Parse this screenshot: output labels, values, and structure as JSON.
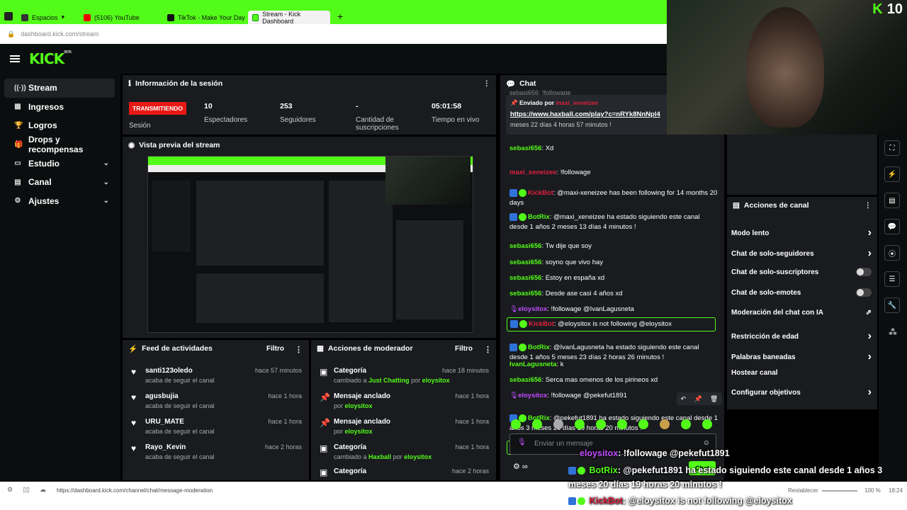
{
  "browser": {
    "tabs": [
      {
        "label": "Espacios"
      },
      {
        "label": "(5106) YouTube"
      },
      {
        "label": "TikTok - Make Your Day"
      },
      {
        "label": "Stream - Kick Dashboard"
      }
    ],
    "url_host": "dashboard.kick.com",
    "url_path": "/stream",
    "status_url": "https://dashboard.kick.com/channel/chat/message-moderation",
    "zoom_label": "Restablecer",
    "zoom": "100 %",
    "clock": "18:24"
  },
  "header": {
    "logo": "KICK",
    "beta": "BETA"
  },
  "sidebar": {
    "items": [
      {
        "label": "Stream",
        "icon": "((·))"
      },
      {
        "label": "Ingresos",
        "icon": "▦"
      },
      {
        "label": "Logros",
        "icon": "🏆"
      },
      {
        "label": "Drops y recompensas",
        "icon": "🎁"
      },
      {
        "label": "Estudio",
        "icon": "▭"
      },
      {
        "label": "Canal",
        "icon": "▤"
      },
      {
        "label": "Ajustes",
        "icon": "⚙"
      }
    ]
  },
  "session": {
    "title": "Información de la sesión",
    "status": "TRANSMITIENDO",
    "status_label": "Sesión",
    "viewers": "10",
    "viewers_label": "Espectadores",
    "followers": "253",
    "followers_label": "Seguidores",
    "subs": "-",
    "subs_label": "Cantidad de suscripciones",
    "uptime": "05:01:58",
    "uptime_label": "Tiempo en vivo"
  },
  "preview": {
    "title": "Vista previa del stream"
  },
  "feed": {
    "title": "Feed de actividades",
    "filter": "Filtro",
    "items": [
      {
        "name": "santi123oledo",
        "sub": "acaba de seguir el canal",
        "time": "hace 57 minutos"
      },
      {
        "name": "agusbujia",
        "sub": "acaba de seguir el canal",
        "time": "hace 1 hora"
      },
      {
        "name": "URU_MATE",
        "sub": "acaba de seguir el canal",
        "time": "hace 1 hora"
      },
      {
        "name": "Rayo_Kevin",
        "sub": "acaba de seguir el canal",
        "time": "hace 2 horas"
      }
    ]
  },
  "mods": {
    "title": "Acciones de moderador",
    "filter": "Filtro",
    "items": [
      {
        "name": "Categoría",
        "pre": "cambiado a",
        "hl1": "Just Chatting",
        "mid": "por",
        "hl2": "eloysitox",
        "time": "hace 18 minutos"
      },
      {
        "name": "Mensaje anclado",
        "pre": "por",
        "hl1": "eloysitox",
        "mid": "",
        "hl2": "",
        "time": "hace 1 hora"
      },
      {
        "name": "Mensaje anclado",
        "pre": "por",
        "hl1": "eloysitox",
        "mid": "",
        "hl2": "",
        "time": "hace 1 hora"
      },
      {
        "name": "Categoría",
        "pre": "cambiado a",
        "hl1": "Haxball",
        "mid": "por",
        "hl2": "eloysitox",
        "time": "hace 1 hora"
      },
      {
        "name": "Categoría",
        "pre": "",
        "hl1": "",
        "mid": "",
        "hl2": "",
        "time": "hace 2 horas"
      }
    ]
  },
  "chat": {
    "title": "Chat",
    "top_partial": "sebasi656: !followage",
    "pinned_by": "Enviado por",
    "pinned_user": "maxi_xeneizee",
    "pinned_link": "https://www.haxball.com/play?c=nRYk8NnNpl4",
    "pinned_tail": "meses 22 días 4 horas 57 minutos !",
    "messages": [
      {
        "user": "sebasi656",
        "color": "green",
        "text": ": Xd"
      },
      {
        "user": "maxi_xeneizee",
        "color": "red",
        "text": ": !followage"
      },
      {
        "user": "KickBot",
        "color": "red",
        "text": ": @maxi-xeneizee has been following for 14 months 20 days"
      },
      {
        "user": "BotRix",
        "color": "green",
        "text": ": @maxi_xeneizee ha estado siguiendo este canal desde 1 años 2 meses 13 días 4 minutos !"
      },
      {
        "user": "sebasi656",
        "color": "green",
        "text": ": Tw dije que soy"
      },
      {
        "user": "sebasi656",
        "color": "green",
        "text": ": soyno que vivo hay"
      },
      {
        "user": "sebasi656",
        "color": "green",
        "text": ": Estoy en españa xd"
      },
      {
        "user": "sebasi656",
        "color": "green",
        "text": ": Desde ase casi 4 años xd"
      },
      {
        "user": "eloysitox",
        "color": "purple",
        "text": ": !followage @IvanLagusneta"
      },
      {
        "user": "KickBot",
        "color": "red",
        "text": ": @eloysitox is not following @eloysitox"
      },
      {
        "user": "BotRix",
        "color": "green",
        "text": ": @IvanLagusneta ha estado siguiendo este canal desde 1 años 5 meses 23 días 2 horas 26 minutos !"
      },
      {
        "user": "IvanLagusneta",
        "color": "green",
        "text": ": k"
      },
      {
        "user": "sebasi656",
        "color": "green",
        "text": ": Serca mas omenos de los pirineos xd"
      },
      {
        "user": "eloysitox",
        "color": "purple",
        "text": ": !followage @pekefut1891"
      },
      {
        "user": "BotRix",
        "color": "green",
        "text": ": @pekefut1891 ha estado siguiendo este canal desde 1 años 3 meses 20 días 19 horas 20 minutos !"
      },
      {
        "user": "KickBot",
        "color": "red",
        "text": ": @eloysitox is not following @eloysitox"
      }
    ],
    "input_placeholder": "Enviar un mensaje",
    "send": "Chat"
  },
  "actions": {
    "title": "Acciones de canal",
    "items": [
      {
        "label": "Modo lento",
        "type": "chevron"
      },
      {
        "label": "Chat de solo-seguidores",
        "type": "chevron"
      },
      {
        "label": "Chat de solo-suscriptores",
        "type": "toggle"
      },
      {
        "label": "Chat de solo-emotes",
        "type": "toggle"
      },
      {
        "label": "Moderación del chat con IA",
        "type": "ext"
      },
      {
        "label": "Restricción de edad",
        "type": "chevron"
      },
      {
        "label": "Palabras baneadas",
        "type": "chevron"
      },
      {
        "label": "Hostear canal",
        "type": "none"
      },
      {
        "label": "Configurar objetivos",
        "type": "chevron"
      }
    ]
  },
  "webcam": {
    "logo": "K",
    "count": "10"
  },
  "overlay": {
    "l1_user": "eloysitox",
    "l1_text": ": !followage @pekefut1891",
    "l2_user": "BotRix",
    "l2_text": ": @pekefut1891 ha estado siguiendo este canal desde 1 años 3",
    "l3_text": "meses 20 días 19 horas 20 minutos !",
    "l4_user": "KickBot",
    "l4_text": ": @eloysitox is not following @eloysitox"
  }
}
